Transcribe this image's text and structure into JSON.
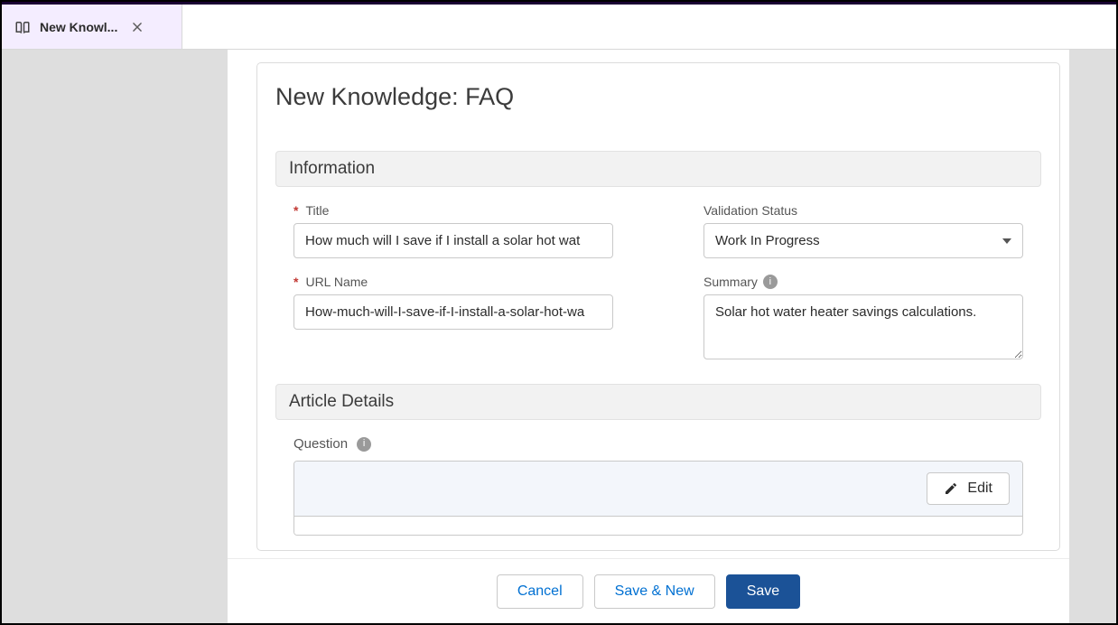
{
  "tab": {
    "label": "New Knowl...",
    "icon": "book-icon"
  },
  "page": {
    "title": "New Knowledge: FAQ"
  },
  "sections": {
    "information": "Information",
    "article_details": "Article Details"
  },
  "fields": {
    "title": {
      "label": "Title",
      "value": "How much will I save if I install a solar hot wat"
    },
    "url_name": {
      "label": "URL Name",
      "value": "How-much-will-I-save-if-I-install-a-solar-hot-wa"
    },
    "validation_status": {
      "label": "Validation Status",
      "value": "Work In Progress"
    },
    "summary": {
      "label": "Summary",
      "value": "Solar hot water heater savings calculations."
    },
    "question": {
      "label": "Question"
    }
  },
  "buttons": {
    "edit": "Edit",
    "cancel": "Cancel",
    "save_new": "Save & New",
    "save": "Save"
  }
}
